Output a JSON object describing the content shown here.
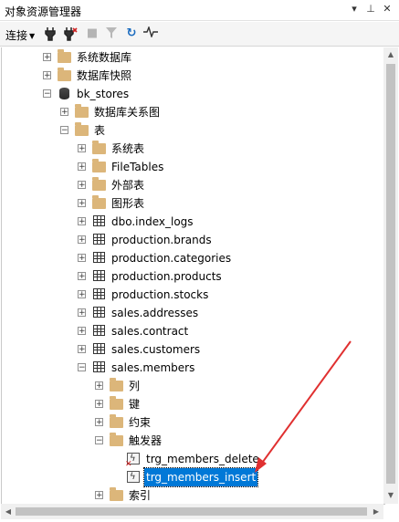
{
  "window": {
    "title": "对象资源管理器"
  },
  "toolbar": {
    "connect_label": "连接"
  },
  "tree": [
    {
      "label": "系统数据库",
      "icon": "folder-icon",
      "expander": "+"
    },
    {
      "label": "数据库快照",
      "icon": "folder-icon",
      "expander": "+"
    },
    {
      "label": "bk_stores",
      "icon": "database-icon",
      "expander": "-"
    },
    {
      "label": "数据库关系图",
      "icon": "folder-icon",
      "expander": "+"
    },
    {
      "label": "表",
      "icon": "folder-icon",
      "expander": "-"
    },
    {
      "label": "系统表",
      "icon": "folder-icon",
      "expander": "+"
    },
    {
      "label": "FileTables",
      "icon": "folder-icon",
      "expander": "+"
    },
    {
      "label": "外部表",
      "icon": "folder-icon",
      "expander": "+"
    },
    {
      "label": "图形表",
      "icon": "folder-icon",
      "expander": "+"
    },
    {
      "label": "dbo.index_logs",
      "icon": "table-icon",
      "expander": "+"
    },
    {
      "label": "production.brands",
      "icon": "table-icon",
      "expander": "+"
    },
    {
      "label": "production.categories",
      "icon": "table-icon",
      "expander": "+"
    },
    {
      "label": "production.products",
      "icon": "table-icon",
      "expander": "+"
    },
    {
      "label": "production.stocks",
      "icon": "table-icon",
      "expander": "+"
    },
    {
      "label": "sales.addresses",
      "icon": "table-icon",
      "expander": "+"
    },
    {
      "label": "sales.contract",
      "icon": "table-icon",
      "expander": "+"
    },
    {
      "label": "sales.customers",
      "icon": "table-icon",
      "expander": "+"
    },
    {
      "label": "sales.members",
      "icon": "table-icon",
      "expander": "-"
    },
    {
      "label": "列",
      "icon": "folder-icon",
      "expander": "+"
    },
    {
      "label": "键",
      "icon": "folder-icon",
      "expander": "+"
    },
    {
      "label": "约束",
      "icon": "folder-icon",
      "expander": "+"
    },
    {
      "label": "触发器",
      "icon": "folder-icon",
      "expander": "-"
    },
    {
      "label": "trg_members_delete",
      "icon": "trigger-disabled-icon",
      "expander": ""
    },
    {
      "label": "trg_members_insert",
      "icon": "trigger-icon",
      "expander": "",
      "selected": true
    },
    {
      "label": "索引",
      "icon": "folder-icon",
      "expander": "+"
    }
  ],
  "colors": {
    "selection": "#0078d7",
    "annotation_arrow": "#e03030",
    "folder": "#dcb67a"
  }
}
